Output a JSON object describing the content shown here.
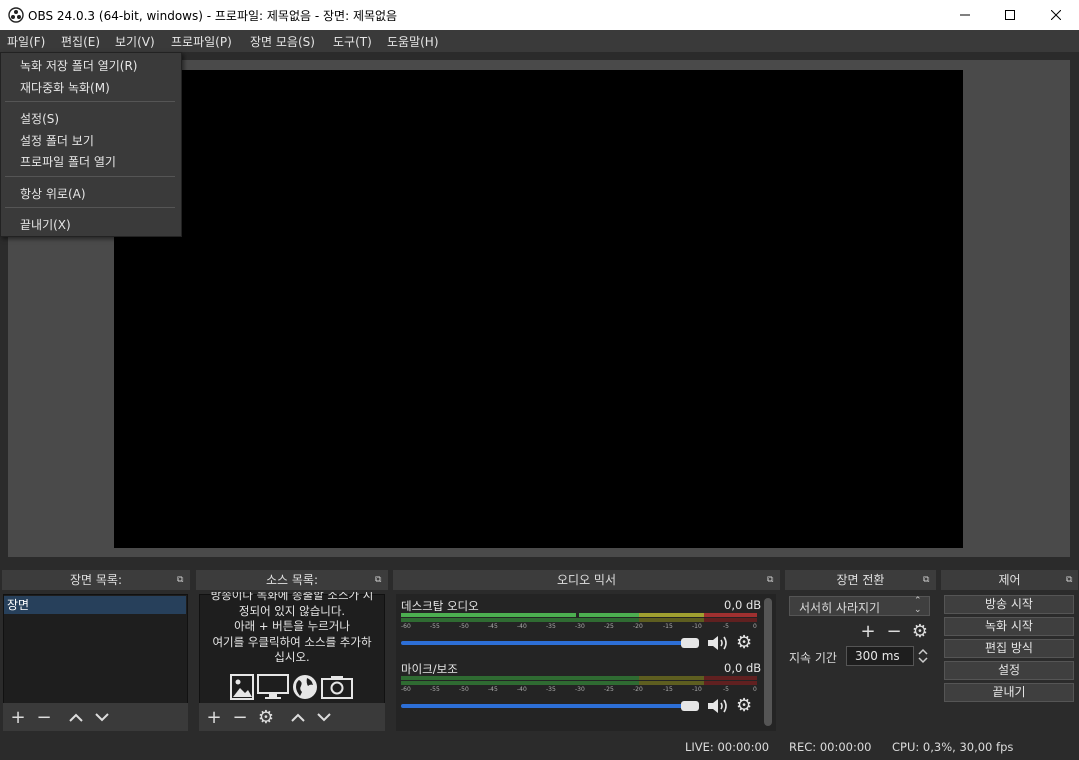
{
  "window": {
    "title": "OBS 24.0.3 (64-bit, windows) - 프로파일: 제목없음 - 장면: 제목없음"
  },
  "menubar": {
    "items": [
      "파일(F)",
      "편집(E)",
      "보기(V)",
      "프로파일(P)",
      "장면 모음(S)",
      "도구(T)",
      "도움말(H)"
    ]
  },
  "file_menu": {
    "items": [
      "녹화 저장 폴더 열기(R)",
      "재다중화 녹화(M)",
      "설정(S)",
      "설정 폴더 보기",
      "프로파일 폴더 열기",
      "항상 위로(A)",
      "끝내기(X)"
    ]
  },
  "docks": {
    "scenes_title": "장면 목록:",
    "sources_title": "소스 목록:",
    "mixer_title": "오디오 믹서",
    "transitions_title": "장면 전환",
    "controls_title": "제어"
  },
  "scenes": {
    "items": [
      "장면"
    ]
  },
  "sources": {
    "hint_lines": [
      "방송이나 녹화에 송출할 소스가 지",
      "정되어 있지 않습니다.",
      "아래 + 버튼을 누르거나",
      "여기를 우클릭하여 소스를 추가하",
      "십시오."
    ]
  },
  "mixer": {
    "scale": [
      "-60",
      "-55",
      "-50",
      "-45",
      "-40",
      "-35",
      "-30",
      "-25",
      "-20",
      "-15",
      "-10",
      "-5",
      "0"
    ],
    "channels": [
      {
        "name": "데스크탑 오디오",
        "db": "0,0 dB"
      },
      {
        "name": "마이크/보조",
        "db": "0,0 dB"
      }
    ]
  },
  "transitions": {
    "selected": "서서히 사라지기",
    "duration_label": "지속 기간",
    "duration_value": "300 ms"
  },
  "controls": {
    "buttons": [
      "방송 시작",
      "녹화 시작",
      "편집 방식",
      "설정",
      "끝내기"
    ]
  },
  "status": {
    "live": "LIVE: 00:00:00",
    "rec": "REC: 00:00:00",
    "cpu": "CPU: 0,3%, 30,00 fps"
  },
  "colors": {
    "meter_green": "#4caf50",
    "meter_yellow": "#a0a030",
    "meter_red": "#a03030",
    "accent_blue": "#2d6fd6"
  }
}
